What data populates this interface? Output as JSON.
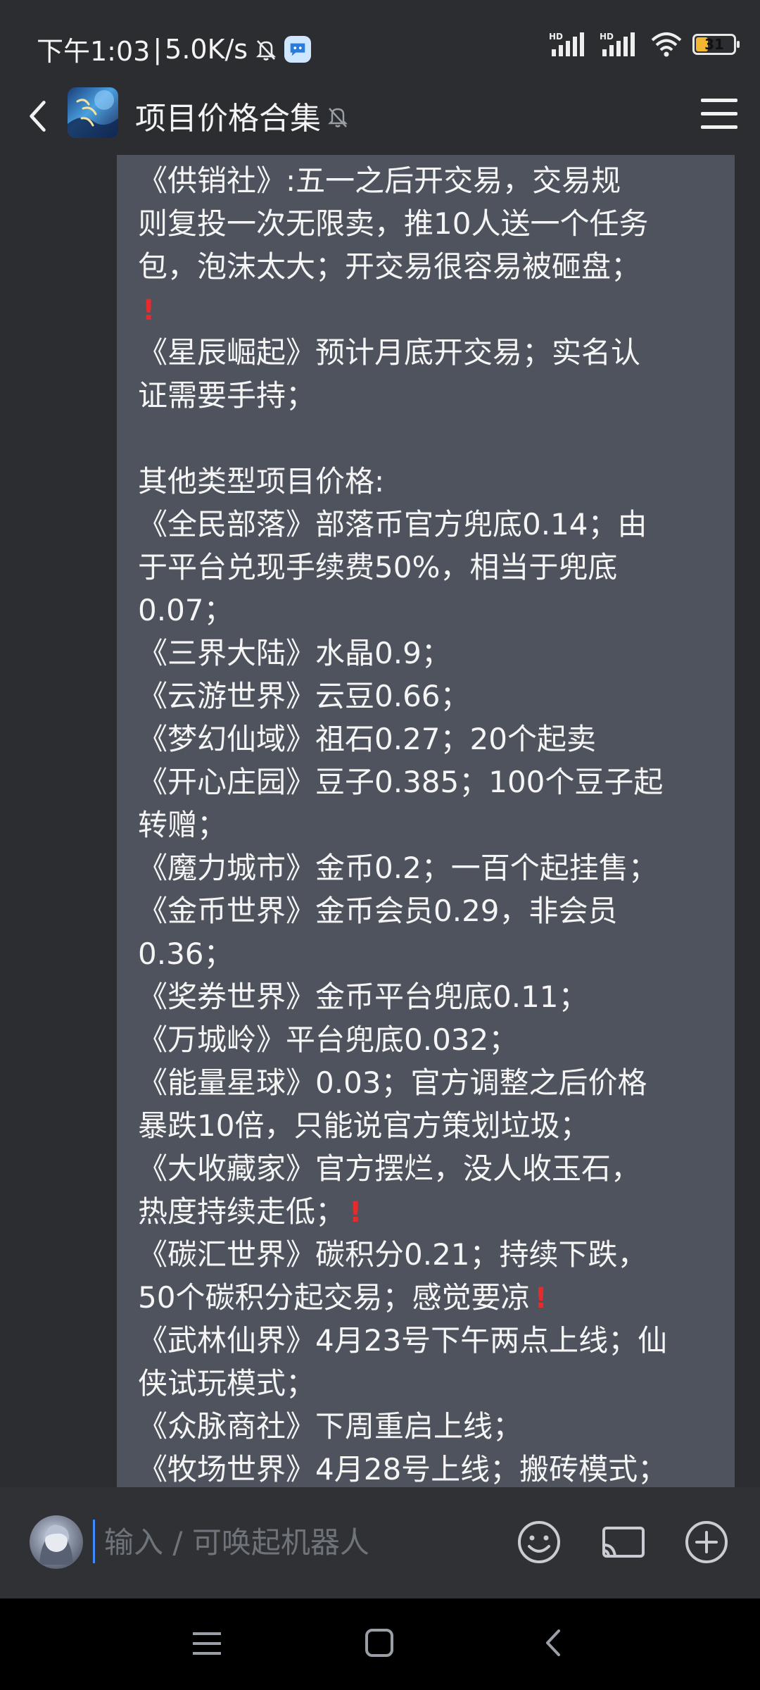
{
  "status_bar": {
    "time": "下午1:03",
    "separator": "|",
    "speed": "5.0K/s",
    "battery_level": "31",
    "battery_fraction": 0.31,
    "battery_color": "#f2b631"
  },
  "header": {
    "title": "项目价格合集",
    "icons": [
      "back-arrow-icon",
      "group-avatar",
      "mute-bell-icon",
      "menu-icon"
    ]
  },
  "message": {
    "bubble_color": "#4e535d",
    "lines": [
      {
        "text": "《供销社》:五一之后开交易，交易规",
        "warn_after": false
      },
      {
        "text": "则复投一次无限卖，推10人送一个任务",
        "warn_after": false
      },
      {
        "text": "包，泡沫太大；开交易很容易被砸盘；",
        "warn_after": false
      },
      {
        "text": "",
        "warn_after": true
      },
      {
        "text": "《星辰崛起》预计月底开交易；实名认",
        "warn_after": false
      },
      {
        "text": "证需要手持；",
        "warn_after": false
      },
      {
        "text": "",
        "warn_after": false
      },
      {
        "text": "其他类型项目价格:",
        "warn_after": false
      },
      {
        "text": "《全民部落》部落币官方兜底0.14；由",
        "warn_after": false
      },
      {
        "text": "于平台兑现手续费50%，相当于兜底",
        "warn_after": false
      },
      {
        "text": "0.07；",
        "warn_after": false
      },
      {
        "text": "《三界大陆》水晶0.9；",
        "warn_after": false
      },
      {
        "text": "《云游世界》云豆0.66；",
        "warn_after": false
      },
      {
        "text": "《梦幻仙域》祖石0.27；20个起卖",
        "warn_after": false
      },
      {
        "text": "《开心庄园》豆子0.385；100个豆子起",
        "warn_after": false
      },
      {
        "text": "转赠；",
        "warn_after": false
      },
      {
        "text": "《魔力城市》金币0.2；一百个起挂售；",
        "warn_after": false
      },
      {
        "text": "《金币世界》金币会员0.29，非会员",
        "warn_after": false
      },
      {
        "text": "0.36；",
        "warn_after": false
      },
      {
        "text": "《奖券世界》金币平台兜底0.11；",
        "warn_after": false
      },
      {
        "text": "《万城岭》平台兜底0.032；",
        "warn_after": false
      },
      {
        "text": "《能量星球》0.03；官方调整之后价格",
        "warn_after": false
      },
      {
        "text": "暴跌10倍，只能说官方策划垃圾；",
        "warn_after": false
      },
      {
        "text": "《大收藏家》官方摆烂，没人收玉石，",
        "warn_after": false
      },
      {
        "text": "热度持续走低；",
        "warn_after": true
      },
      {
        "text": "《碳汇世界》碳积分0.21；持续下跌，",
        "warn_after": false
      },
      {
        "text": "50个碳积分起交易；感觉要凉",
        "warn_after": true
      },
      {
        "text": "《武林仙界》4月23号下午两点上线；仙",
        "warn_after": false
      },
      {
        "text": "侠试玩模式；",
        "warn_after": false
      },
      {
        "text": "《众脉商社》下周重启上线；",
        "warn_after": false
      },
      {
        "text": "《牧场世界》4月28号上线；搬砖模式；",
        "warn_after": false
      }
    ],
    "warn_glyph": "!"
  },
  "input_bar": {
    "placeholder": "输入 / 可唤起机器人",
    "icons": [
      "user-avatar",
      "emoji-icon",
      "screen-share-icon",
      "plus-icon"
    ]
  },
  "nav_bar": {
    "icons": [
      "menu-nav-icon",
      "home-nav-icon",
      "back-nav-icon"
    ]
  }
}
